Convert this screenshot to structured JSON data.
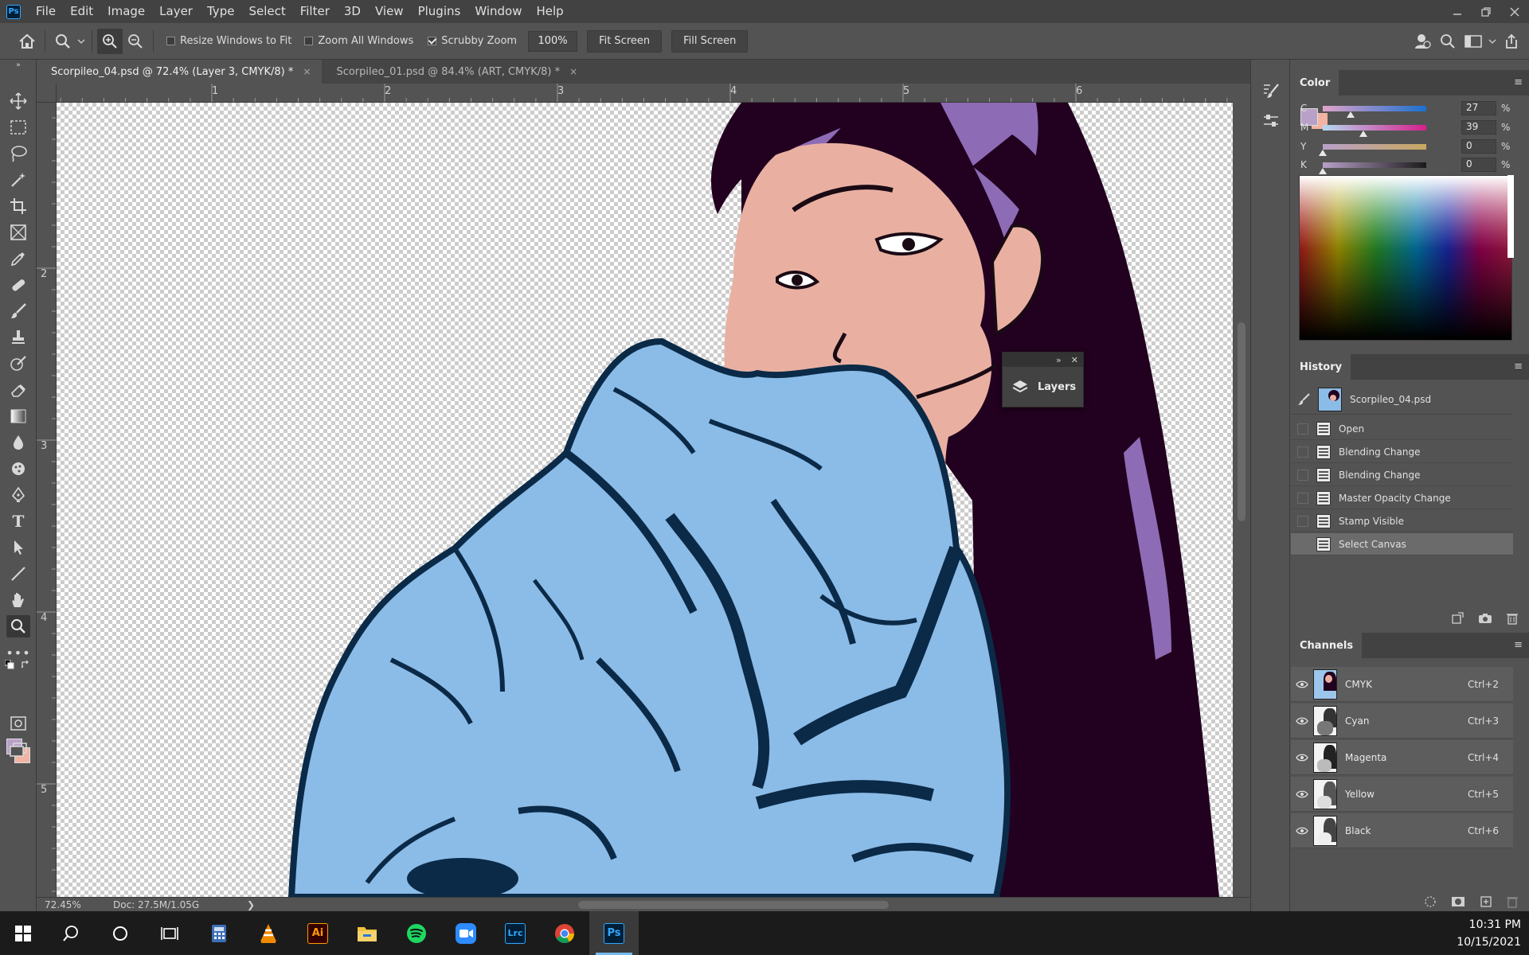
{
  "app": {
    "logo": "Ps"
  },
  "menu": [
    "File",
    "Edit",
    "Image",
    "Layer",
    "Type",
    "Select",
    "Filter",
    "3D",
    "View",
    "Plugins",
    "Window",
    "Help"
  ],
  "options": {
    "resize_windows": "Resize Windows to Fit",
    "zoom_all": "Zoom All Windows",
    "scrubby_zoom": "Scrubby Zoom",
    "zoom_value": "100%",
    "fit_screen": "Fit Screen",
    "fill_screen": "Fill Screen",
    "resize_checked": false,
    "zoom_all_checked": false,
    "scrubby_checked": true
  },
  "tabs": [
    {
      "title": "Scorpileo_04.psd @ 72.4% (Layer 3, CMYK/8) *",
      "close": "×",
      "active": true
    },
    {
      "title": "Scorpileo_01.psd @ 84.4% (ART, CMYK/8) *",
      "close": "×",
      "active": false
    }
  ],
  "ruler": {
    "top": [
      "1",
      "2",
      "3",
      "4",
      "5",
      "6"
    ],
    "left": [
      "2",
      "3",
      "4",
      "5"
    ]
  },
  "status": {
    "zoom": "72.45%",
    "doc": "Doc: 27.5M/1.05G",
    "arrow": "❯"
  },
  "floating_layers": {
    "label": "Layers"
  },
  "color_panel": {
    "title": "Color",
    "foreground": "#b9a0c9",
    "background": "#f2b3a3",
    "channels": [
      {
        "letter": "C",
        "value": "27",
        "unit": "%",
        "level": 0.27
      },
      {
        "letter": "M",
        "value": "39",
        "unit": "%",
        "level": 0.39
      },
      {
        "letter": "Y",
        "value": "0",
        "unit": "%",
        "level": 0
      },
      {
        "letter": "K",
        "value": "0",
        "unit": "%",
        "level": 0
      }
    ]
  },
  "history_panel": {
    "title": "History",
    "snapshot": "Scorpileo_04.psd",
    "steps": [
      "Open",
      "Blending Change",
      "Blending Change",
      "Master Opacity Change",
      "Stamp Visible",
      "Select Canvas"
    ],
    "selected_index": 5
  },
  "channels_panel": {
    "title": "Channels",
    "channels": [
      {
        "name": "CMYK",
        "shortcut": "Ctrl+2"
      },
      {
        "name": "Cyan",
        "shortcut": "Ctrl+3"
      },
      {
        "name": "Magenta",
        "shortcut": "Ctrl+4"
      },
      {
        "name": "Yellow",
        "shortcut": "Ctrl+5"
      },
      {
        "name": "Black",
        "shortcut": "Ctrl+6"
      }
    ]
  },
  "taskbar": {
    "apps": [
      "windows-start",
      "search",
      "cortana",
      "task-view",
      "calculator",
      "vlc",
      "illustrator",
      "file-explorer",
      "spotify",
      "zoom",
      "lightroom-classic",
      "chrome",
      "photoshop"
    ],
    "illustrator_label": "Ai",
    "lightroom_label": "Lrc",
    "photoshop_label": "Ps",
    "time": "10:31 PM",
    "date": "10/15/2021"
  }
}
